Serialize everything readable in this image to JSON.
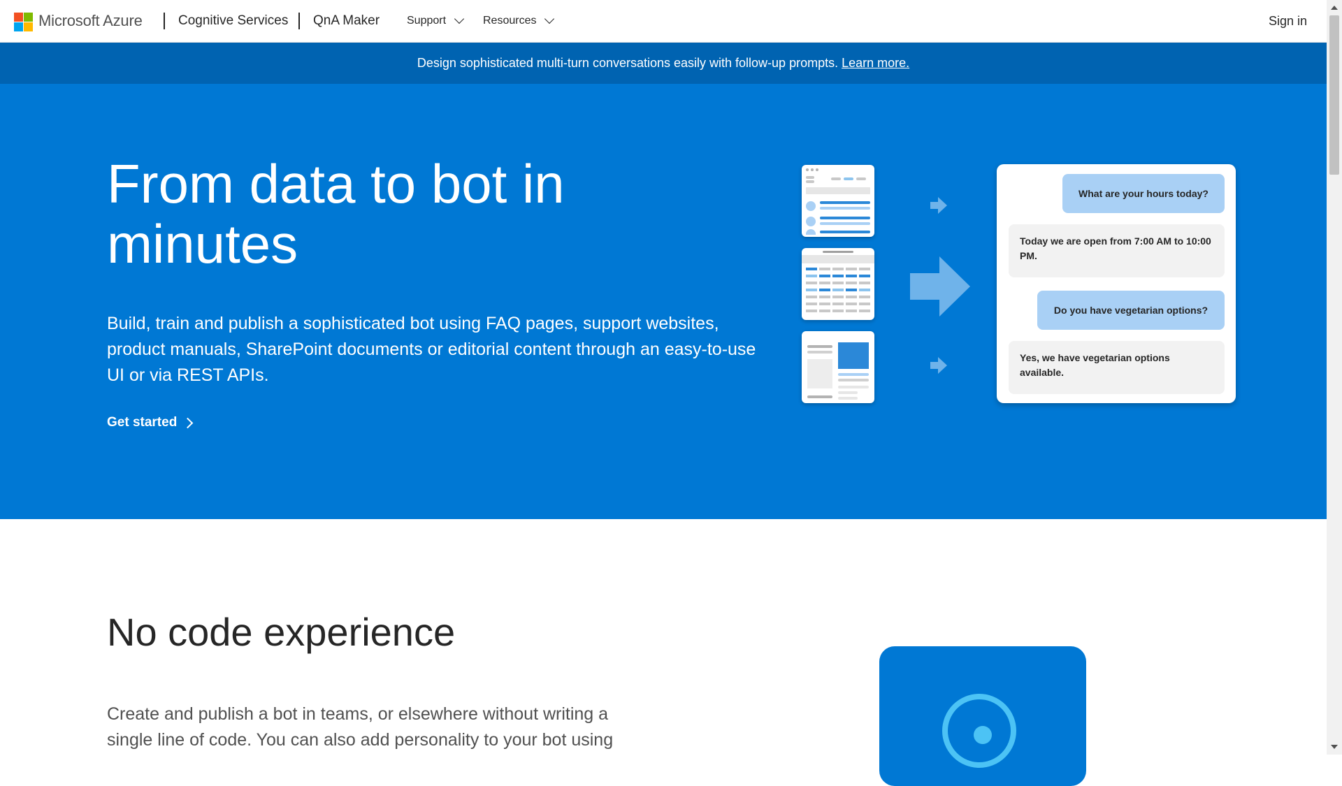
{
  "header": {
    "brand": "Microsoft Azure",
    "cognitive_services": "Cognitive Services",
    "qna_maker": "QnA Maker",
    "menus": [
      {
        "label": "Support"
      },
      {
        "label": "Resources"
      }
    ],
    "sign_in": "Sign in",
    "logo_colors": [
      "#f25022",
      "#7fba00",
      "#00a4ef",
      "#ffb900"
    ]
  },
  "banner": {
    "text": "Design sophisticated multi-turn conversations easily with follow-up prompts.",
    "link": "Learn more."
  },
  "hero": {
    "title": "From data to bot in minutes",
    "description": "Build, train and publish a sophisticated bot using FAQ pages, support websites, product manuals, SharePoint documents or editorial content through an easy-to-use UI or via REST APIs.",
    "cta": "Get started",
    "background": "#0078d4",
    "chat": [
      {
        "role": "user",
        "text": "What are your hours today?"
      },
      {
        "role": "bot",
        "text": "Today we are open from 7:00 AM to 10:00 PM."
      },
      {
        "role": "user",
        "text": "Do you have vegetarian options?"
      },
      {
        "role": "bot",
        "text": "Yes, we have vegetarian options available."
      }
    ]
  },
  "section": {
    "title": "No code experience",
    "description": "Create and publish a bot in teams, or elsewhere without writing a single line of code. You can also add personality to your bot using"
  }
}
